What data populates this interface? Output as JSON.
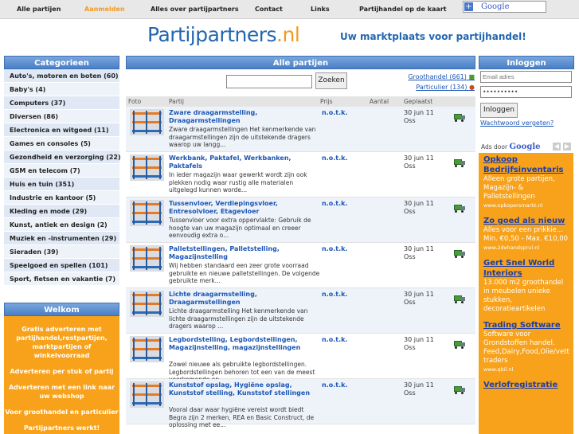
{
  "nav": {
    "items": [
      "Alle partijen",
      "Aanmelden",
      "Alles over partijpartners",
      "Contact",
      "Links",
      "Partijhandel op de kaart"
    ],
    "active_index": 1,
    "google_label": "Google"
  },
  "header": {
    "logo_main": "Partijpartners",
    "logo_tld": ".nl",
    "tagline": "Uw marktplaats voor partijhandel!"
  },
  "sidebar": {
    "title": "Categorieen",
    "items": [
      "Auto's, motoren en boten (60)",
      "Baby's (4)",
      "Computers (37)",
      "Diversen (86)",
      "Electronica en witgoed (11)",
      "Games en consoles (5)",
      "Gezondheid en verzorging (22)",
      "GSM en telecom (7)",
      "Huis en tuin (351)",
      "Industrie en kantoor (5)",
      "Kleding en mode (29)",
      "Kunst, antiek en design (2)",
      "Muziek en -instrumenten (29)",
      "Sieraden (39)",
      "Speelgoed en spellen (101)",
      "Sport, fietsen en vakantie (7)"
    ],
    "welkom_title": "Welkom",
    "welkom_lines": [
      "Gratis adverteren met partijhandel,restpartijen, marktpartijen of winkelvoorraad",
      "Adverteren per stuk of partij",
      "Adverteren met een link naar uw webshop",
      "Voor groothandel en particulier",
      "Partijpartners werkt!"
    ]
  },
  "main": {
    "title": "Alle partijen",
    "search_button": "Zoeken",
    "filter_groothandel": "Groothandel (661)",
    "filter_particulier": "Particulier (134)",
    "columns": [
      "Foto",
      "Partij",
      "Prijs",
      "Aantal",
      "Geplaatst"
    ],
    "rows": [
      {
        "title": "Zware draagarmstelling, Draagarmstellingen",
        "desc": "Zware draagarmstellingen Het kenmerkende van draagarmstellingen zijn de uitstekende dragers waarop uw langg...",
        "price": "n.o.t.k.",
        "date": "30 jun 11",
        "place": "Oss"
      },
      {
        "title": "Werkbank, Paktafel, Werkbanken, Paktafels",
        "desc": "In ieder magazijn waar gewerkt wordt zijn ook plekken nodig waar rustig alle materialen uitgelegd kunnen worde...",
        "price": "n.o.t.k.",
        "date": "30 jun 11",
        "place": "Oss"
      },
      {
        "title": "Tussenvloer, Verdiepingsvloer, Entresolvloer, Etagevloer",
        "desc": "Tussenvloer voor extra oppervlakte: Gebruik de hoogte van uw magazijn optimaal en creeer eenvoudig extra o...",
        "price": "n.o.t.k.",
        "date": "30 jun 11",
        "place": "Oss"
      },
      {
        "title": "Palletstellingen, Palletstelling, Magazijnstelling",
        "desc": "Wij hebben standaard een zeer grote voorraad gebruikte en nieuwe palletstellingen. De volgende gebruikte merk...",
        "price": "n.o.t.k.",
        "date": "30 jun 11",
        "place": "Oss"
      },
      {
        "title": "Lichte draagarmstelling, Draagarmstellingen",
        "desc": "Lichte draagarmstelling Het kenmerkende van lichte draagarmstellingen zijn de uitstekende dragers waarop ...",
        "price": "n.o.t.k.",
        "date": "30 jun 11",
        "place": "Oss"
      },
      {
        "title": "Legbordstelling, Legbordstellingen, Magazijnstelling, magazijnstellingen",
        "desc": "Zowel nieuwe als gebruikte legbordstellingen. Legbordstellingen behoren tot een van de meest voorkomende op...",
        "price": "n.o.t.k.",
        "date": "30 jun 11",
        "place": "Oss"
      },
      {
        "title": "Kunststof opslag, Hygiëne opslag, Kunststof stelling, Kunststof stellingen",
        "desc": "Vooral daar waar hygiëne vereist wordt biedt Begra zijn 2 merken, REA en Basic Construct, de oplossing met ee...",
        "price": "n.o.t.k.",
        "date": "30 jun 11",
        "place": "Oss"
      }
    ]
  },
  "login": {
    "title": "Inloggen",
    "email_placeholder": "Email adres",
    "password_mask": "••••••••••",
    "button": "Inloggen",
    "forgot": "Wachtwoord vergeten?"
  },
  "ads": {
    "label": "Ads door",
    "google": "Google",
    "items": [
      {
        "headline": "Opkoop Bedrijfsinventaris",
        "body": "Alleen grote partijen, Magazijn- & Palletstellingen",
        "url": "www.opkopersmarkt.nl"
      },
      {
        "headline": "Zo goed als nieuw",
        "body": "Alles voor een prikkie... Min. €0,50 - Max. €10,00",
        "url": "www.2dehandsprul.nl"
      },
      {
        "headline": "Gert Snel World Interiors",
        "body": "13.000 m2 groothandel in meubelen unieke stukken, decoratieartikelen",
        "url": ""
      },
      {
        "headline": "Trading Software",
        "body": "Software voor Grondstoffen handel. Feed,Dairy,Food,Olie/vett traders",
        "url": "www.qbil.nl"
      },
      {
        "headline": "Verlofregistratie",
        "body": "",
        "url": ""
      }
    ]
  },
  "colors": {
    "accent_orange": "#f7a21a",
    "header_blue": "#4a7fc6",
    "link_blue": "#1b56b5"
  }
}
